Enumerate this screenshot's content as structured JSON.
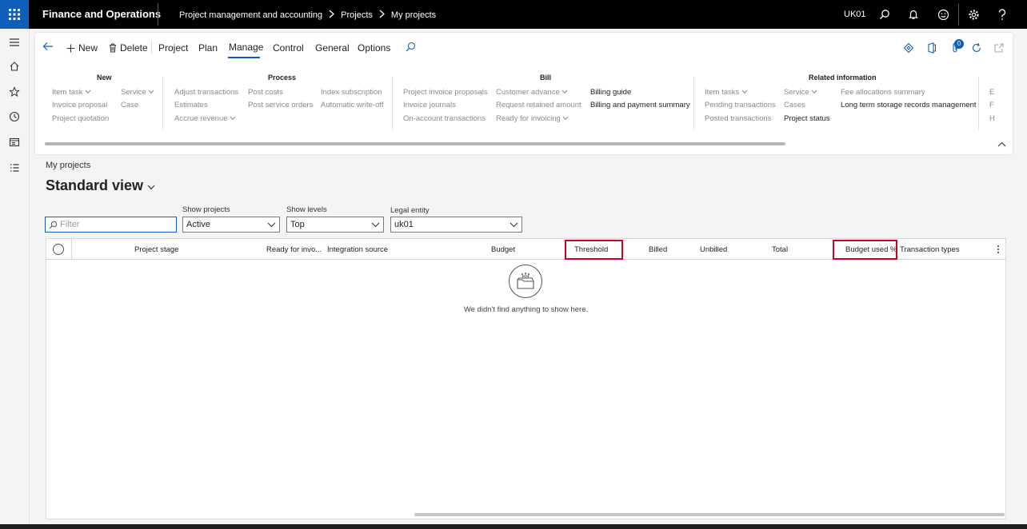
{
  "topbar": {
    "app_title": "Finance and Operations",
    "breadcrumbs": [
      "Project management and accounting",
      "Projects",
      "My projects"
    ],
    "company": "UK01"
  },
  "toolbar": {
    "new_label": "New",
    "delete_label": "Delete",
    "tabs": [
      "Project",
      "Plan",
      "Manage",
      "Control",
      "General",
      "Options"
    ],
    "active_tab": "Manage",
    "attachments_count": "0"
  },
  "groups": {
    "new": {
      "title": "New",
      "items": [
        "Item task",
        "Invoice proposal",
        "Project quotation",
        "Service",
        "Case"
      ]
    },
    "process": {
      "title": "Process",
      "items": [
        "Adjust transactions",
        "Estimates",
        "Accrue revenue",
        "Post costs",
        "Post service orders",
        "Index subscription",
        "Automatic write-off"
      ]
    },
    "bill": {
      "title": "Bill",
      "items": [
        "Project invoice proposals",
        "Invoice journals",
        "On-account transactions",
        "Customer advance",
        "Request retained amount",
        "Ready for invoicing",
        "Billing guide",
        "Billing and payment summary"
      ]
    },
    "related": {
      "title": "Related information",
      "items": [
        "Item tasks",
        "Pending transactions",
        "Posted transactions",
        "Service",
        "Cases",
        "Project status",
        "Fee allocations summary",
        "Long term storage records management"
      ]
    },
    "overflow": {
      "items": [
        "E",
        "F",
        "H"
      ]
    }
  },
  "page": {
    "caption": "My projects",
    "view_name": "Standard view"
  },
  "filters": {
    "filter_placeholder": "Filter",
    "show_projects_label": "Show projects",
    "show_projects_value": "Active",
    "show_levels_label": "Show levels",
    "show_levels_value": "Top",
    "legal_entity_label": "Legal entity",
    "legal_entity_value": "uk01"
  },
  "grid": {
    "columns": [
      "Project stage",
      "Ready for invo...",
      "Integration source",
      "Budget",
      "Threshold",
      "Billed",
      "Unbilled",
      "Total",
      "Budget used %",
      "Transaction types"
    ],
    "empty_message": "We didn't find anything to show here."
  },
  "colors": {
    "accent": "#0f5dbc",
    "highlight": "#d0021b"
  }
}
